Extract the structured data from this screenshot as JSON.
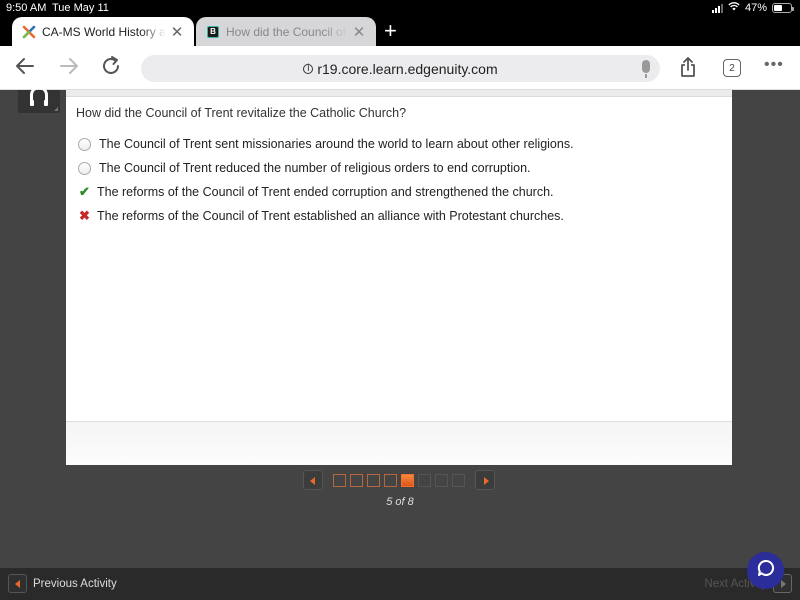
{
  "status_bar": {
    "time": "9:50 AM",
    "date": "Tue May 11",
    "battery": "47%",
    "battery_level": 0.47
  },
  "tabs": [
    {
      "title": "CA-MS World History and",
      "favicon": "edgenuity-x-icon",
      "active": true
    },
    {
      "title": "How did the Council of Trent",
      "favicon": "brainly-b-icon",
      "active": false
    }
  ],
  "toolbar": {
    "url": "r19.core.learn.edgenuity.com",
    "tab_count": "2"
  },
  "question": {
    "prompt": "How did the Council of Trent revitalize the Catholic Church?",
    "options": [
      {
        "text": "The Council of Trent sent missionaries around the world to learn about other religions.",
        "state": "unselected"
      },
      {
        "text": "The Council of Trent reduced the number of religious orders to end corruption.",
        "state": "unselected"
      },
      {
        "text": "The reforms of the Council of Trent ended corruption and strengthened the church.",
        "state": "correct"
      },
      {
        "text": "The reforms of the Council of Trent established an alliance with Protestant churches.",
        "state": "incorrect"
      }
    ]
  },
  "pager": {
    "current": 5,
    "total": 8,
    "label": "5 of 8"
  },
  "footer": {
    "previous_label": "Previous Activity",
    "next_label": "Next Activity"
  },
  "colors": {
    "accent": "#e8692a",
    "correct": "#2e8b2e",
    "incorrect": "#c62828",
    "chat": "#2b2d9a"
  }
}
